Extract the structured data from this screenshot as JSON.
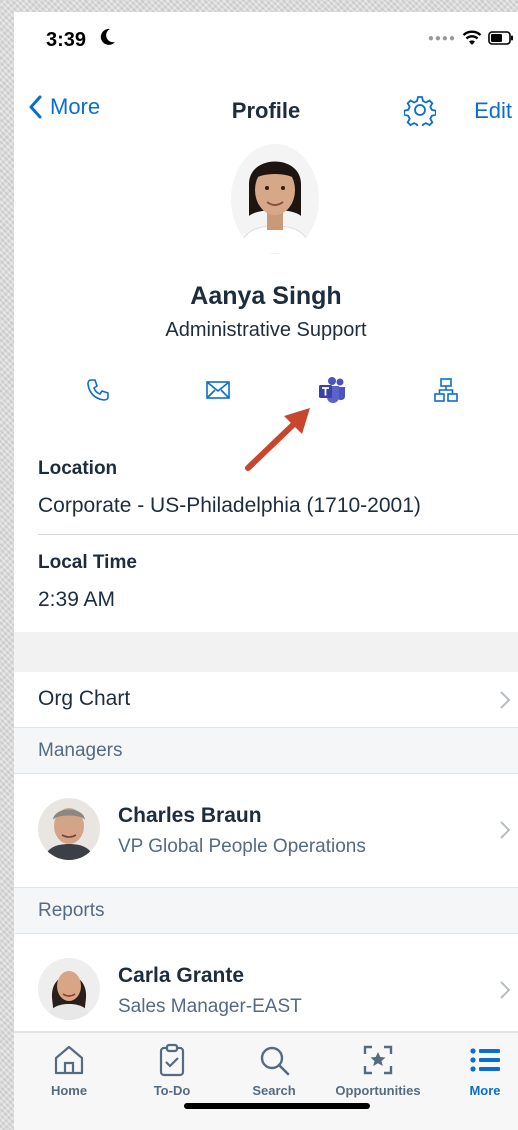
{
  "status": {
    "time": "3:39"
  },
  "nav": {
    "back_label": "More",
    "title": "Profile",
    "edit_label": "Edit"
  },
  "profile": {
    "name": "Aanya Singh",
    "title": "Administrative Support"
  },
  "info": {
    "location_label": "Location",
    "location_value": "Corporate - US-Philadelphia (1710-2001)",
    "local_time_label": "Local Time",
    "local_time_value": "2:39 AM"
  },
  "org_chart_label": "Org Chart",
  "managers": {
    "header": "Managers",
    "items": [
      {
        "name": "Charles Braun",
        "role": "VP Global People Operations"
      }
    ]
  },
  "reports": {
    "header": "Reports",
    "items": [
      {
        "name": "Carla Grante",
        "role": "Sales Manager-EAST"
      }
    ]
  },
  "tabs": [
    {
      "label": "Home",
      "icon": "home-icon"
    },
    {
      "label": "To-Do",
      "icon": "clipboard-check-icon"
    },
    {
      "label": "Search",
      "icon": "search-icon"
    },
    {
      "label": "Opportunities",
      "icon": "star-frame-icon"
    },
    {
      "label": "More",
      "icon": "list-icon",
      "active": true
    }
  ],
  "colors": {
    "accent": "#0a6ed1",
    "text": "#1d2d3e",
    "muted": "#556b82",
    "annotation_arrow": "#c8452e"
  }
}
